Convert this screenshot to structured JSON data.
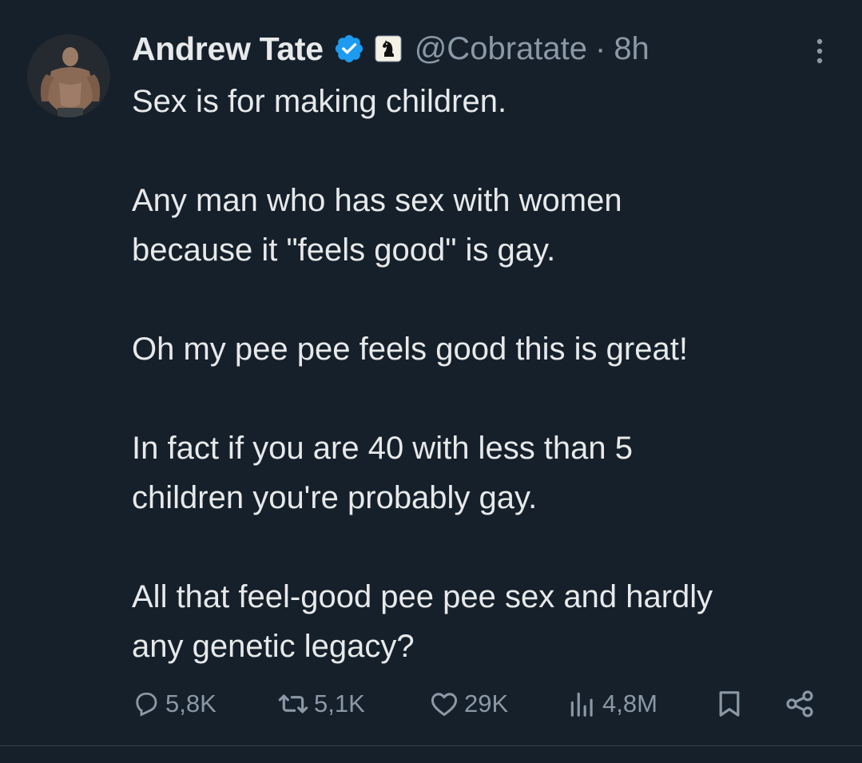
{
  "tweet": {
    "display_name": "Andrew Tate",
    "handle": "@Cobratate",
    "separator": "·",
    "time": "8h",
    "paragraphs": [
      [
        "Sex is for making children."
      ],
      [
        "Any man who has sex with women",
        "because it \"feels good\" is gay."
      ],
      [
        "Oh my pee pee feels good this is great!"
      ],
      [
        "In fact if you are 40 with less than 5",
        "children you're probably gay."
      ],
      [
        "All that feel-good pee pee sex and hardly",
        "any genetic legacy?"
      ]
    ]
  },
  "actions": {
    "replies": "5,8K",
    "retweets": "5,1K",
    "likes": "29K",
    "views": "4,8M"
  },
  "icons": {
    "verified": "verified-badge-icon",
    "affiliate": "knight-affiliate-icon",
    "more": "more-options-icon",
    "reply": "reply-icon",
    "retweet": "retweet-icon",
    "like": "heart-icon",
    "views": "views-chart-icon",
    "bookmark": "bookmark-icon",
    "share": "share-icon"
  },
  "colors": {
    "background": "#15202b",
    "text": "#e7e9ea",
    "secondary": "#8b98a5",
    "verified": "#1d9bf0"
  }
}
